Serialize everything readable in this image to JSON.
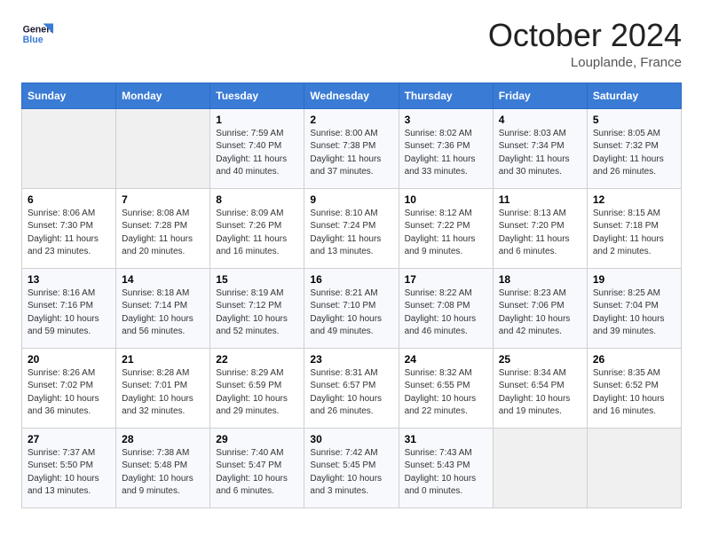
{
  "header": {
    "logo_line1": "General",
    "logo_line2": "Blue",
    "month": "October 2024",
    "location": "Louplande, France"
  },
  "columns": [
    "Sunday",
    "Monday",
    "Tuesday",
    "Wednesday",
    "Thursday",
    "Friday",
    "Saturday"
  ],
  "weeks": [
    [
      {
        "day": "",
        "content": ""
      },
      {
        "day": "",
        "content": ""
      },
      {
        "day": "1",
        "content": "Sunrise: 7:59 AM\nSunset: 7:40 PM\nDaylight: 11 hours\nand 40 minutes."
      },
      {
        "day": "2",
        "content": "Sunrise: 8:00 AM\nSunset: 7:38 PM\nDaylight: 11 hours\nand 37 minutes."
      },
      {
        "day": "3",
        "content": "Sunrise: 8:02 AM\nSunset: 7:36 PM\nDaylight: 11 hours\nand 33 minutes."
      },
      {
        "day": "4",
        "content": "Sunrise: 8:03 AM\nSunset: 7:34 PM\nDaylight: 11 hours\nand 30 minutes."
      },
      {
        "day": "5",
        "content": "Sunrise: 8:05 AM\nSunset: 7:32 PM\nDaylight: 11 hours\nand 26 minutes."
      }
    ],
    [
      {
        "day": "6",
        "content": "Sunrise: 8:06 AM\nSunset: 7:30 PM\nDaylight: 11 hours\nand 23 minutes."
      },
      {
        "day": "7",
        "content": "Sunrise: 8:08 AM\nSunset: 7:28 PM\nDaylight: 11 hours\nand 20 minutes."
      },
      {
        "day": "8",
        "content": "Sunrise: 8:09 AM\nSunset: 7:26 PM\nDaylight: 11 hours\nand 16 minutes."
      },
      {
        "day": "9",
        "content": "Sunrise: 8:10 AM\nSunset: 7:24 PM\nDaylight: 11 hours\nand 13 minutes."
      },
      {
        "day": "10",
        "content": "Sunrise: 8:12 AM\nSunset: 7:22 PM\nDaylight: 11 hours\nand 9 minutes."
      },
      {
        "day": "11",
        "content": "Sunrise: 8:13 AM\nSunset: 7:20 PM\nDaylight: 11 hours\nand 6 minutes."
      },
      {
        "day": "12",
        "content": "Sunrise: 8:15 AM\nSunset: 7:18 PM\nDaylight: 11 hours\nand 2 minutes."
      }
    ],
    [
      {
        "day": "13",
        "content": "Sunrise: 8:16 AM\nSunset: 7:16 PM\nDaylight: 10 hours\nand 59 minutes."
      },
      {
        "day": "14",
        "content": "Sunrise: 8:18 AM\nSunset: 7:14 PM\nDaylight: 10 hours\nand 56 minutes."
      },
      {
        "day": "15",
        "content": "Sunrise: 8:19 AM\nSunset: 7:12 PM\nDaylight: 10 hours\nand 52 minutes."
      },
      {
        "day": "16",
        "content": "Sunrise: 8:21 AM\nSunset: 7:10 PM\nDaylight: 10 hours\nand 49 minutes."
      },
      {
        "day": "17",
        "content": "Sunrise: 8:22 AM\nSunset: 7:08 PM\nDaylight: 10 hours\nand 46 minutes."
      },
      {
        "day": "18",
        "content": "Sunrise: 8:23 AM\nSunset: 7:06 PM\nDaylight: 10 hours\nand 42 minutes."
      },
      {
        "day": "19",
        "content": "Sunrise: 8:25 AM\nSunset: 7:04 PM\nDaylight: 10 hours\nand 39 minutes."
      }
    ],
    [
      {
        "day": "20",
        "content": "Sunrise: 8:26 AM\nSunset: 7:02 PM\nDaylight: 10 hours\nand 36 minutes."
      },
      {
        "day": "21",
        "content": "Sunrise: 8:28 AM\nSunset: 7:01 PM\nDaylight: 10 hours\nand 32 minutes."
      },
      {
        "day": "22",
        "content": "Sunrise: 8:29 AM\nSunset: 6:59 PM\nDaylight: 10 hours\nand 29 minutes."
      },
      {
        "day": "23",
        "content": "Sunrise: 8:31 AM\nSunset: 6:57 PM\nDaylight: 10 hours\nand 26 minutes."
      },
      {
        "day": "24",
        "content": "Sunrise: 8:32 AM\nSunset: 6:55 PM\nDaylight: 10 hours\nand 22 minutes."
      },
      {
        "day": "25",
        "content": "Sunrise: 8:34 AM\nSunset: 6:54 PM\nDaylight: 10 hours\nand 19 minutes."
      },
      {
        "day": "26",
        "content": "Sunrise: 8:35 AM\nSunset: 6:52 PM\nDaylight: 10 hours\nand 16 minutes."
      }
    ],
    [
      {
        "day": "27",
        "content": "Sunrise: 7:37 AM\nSunset: 5:50 PM\nDaylight: 10 hours\nand 13 minutes."
      },
      {
        "day": "28",
        "content": "Sunrise: 7:38 AM\nSunset: 5:48 PM\nDaylight: 10 hours\nand 9 minutes."
      },
      {
        "day": "29",
        "content": "Sunrise: 7:40 AM\nSunset: 5:47 PM\nDaylight: 10 hours\nand 6 minutes."
      },
      {
        "day": "30",
        "content": "Sunrise: 7:42 AM\nSunset: 5:45 PM\nDaylight: 10 hours\nand 3 minutes."
      },
      {
        "day": "31",
        "content": "Sunrise: 7:43 AM\nSunset: 5:43 PM\nDaylight: 10 hours\nand 0 minutes."
      },
      {
        "day": "",
        "content": ""
      },
      {
        "day": "",
        "content": ""
      }
    ]
  ]
}
